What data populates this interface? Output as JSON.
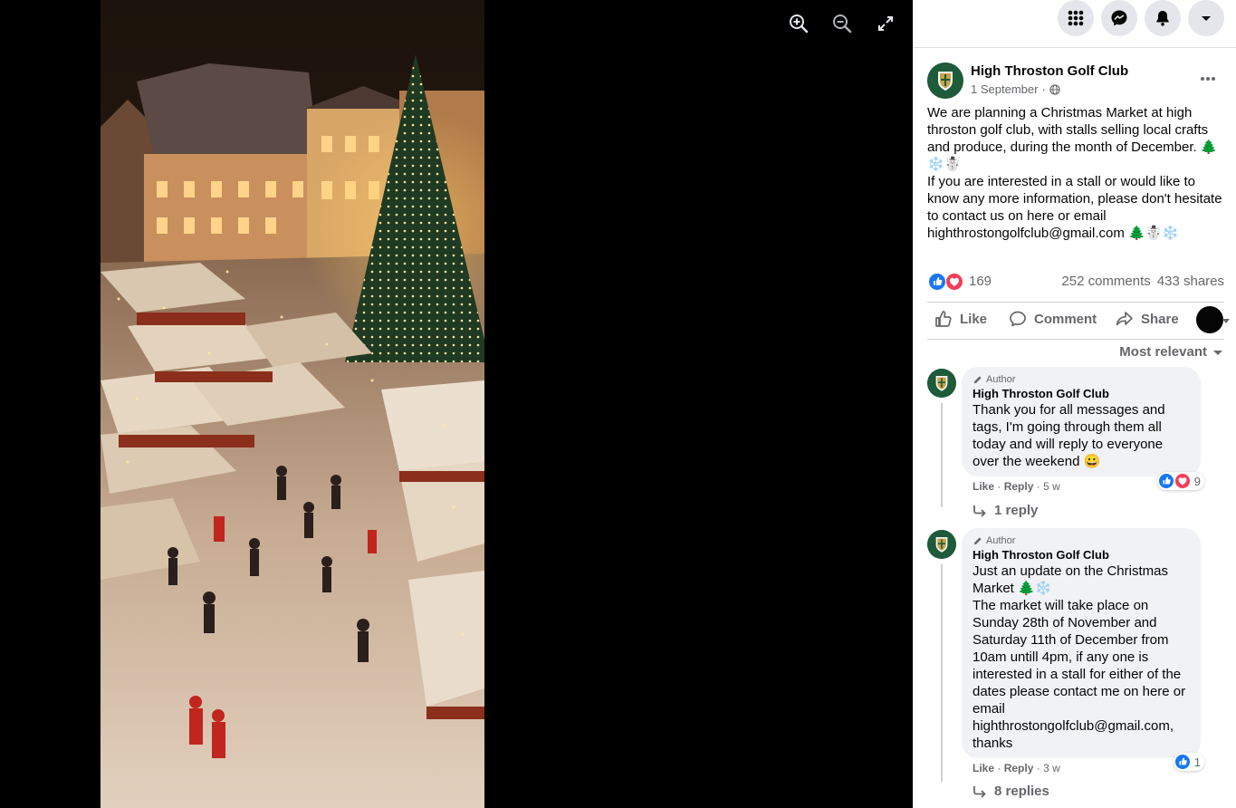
{
  "viewer": {
    "zoom_in_icon": "zoom-in-icon",
    "zoom_out_icon": "zoom-out-icon",
    "fullscreen_icon": "expand-icon"
  },
  "topbar": {
    "icons": [
      "grid-menu-icon",
      "messenger-icon",
      "bell-icon",
      "caret-down-icon"
    ]
  },
  "post": {
    "author": "High Throston Golf Club",
    "date": "1 September",
    "privacy_icon": "globe-icon",
    "paragraph1": "We are planning a Christmas Market at high throston golf club, with stalls selling local crafts and produce, during the month of December. 🌲❄️☃️",
    "paragraph2": "If you are interested in a stall or would like to know any more information, please don't hesitate to contact us on here or email highthrostongolfclub@gmail.com 🌲☃️❄️",
    "reaction_count": "169",
    "comments": "252 comments",
    "shares": "433 shares"
  },
  "actions": {
    "like": "Like",
    "comment": "Comment",
    "share": "Share"
  },
  "sort_label": "Most relevant",
  "comments": [
    {
      "tag": "Author",
      "name": "High Throston Golf Club",
      "lines": [
        "Thank you for all messages and tags, I'm going through them all today and will reply to everyone over the weekend 😀"
      ],
      "like": "Like",
      "reply": "Reply",
      "time": "5 w",
      "reaction_count": "9",
      "replies": "1 reply"
    },
    {
      "tag": "Author",
      "name": "High Throston Golf Club",
      "lines": [
        "Just an update on the Christmas Market 🌲❄️",
        "The market will take place on Sunday 28th of November and Saturday 11th of December from 10am untill 4pm, if any one is interested in a stall for either of the dates please contact me on here or email highthrostongolfclub@gmail.com, thanks"
      ],
      "like": "Like",
      "reply": "Reply",
      "time": "3 w",
      "reaction_count": "1",
      "replies": "8 replies"
    }
  ],
  "colors": {
    "like_blue": "#1877f2",
    "love_red": "#f33e58",
    "club_green": "#1d5b3a"
  }
}
